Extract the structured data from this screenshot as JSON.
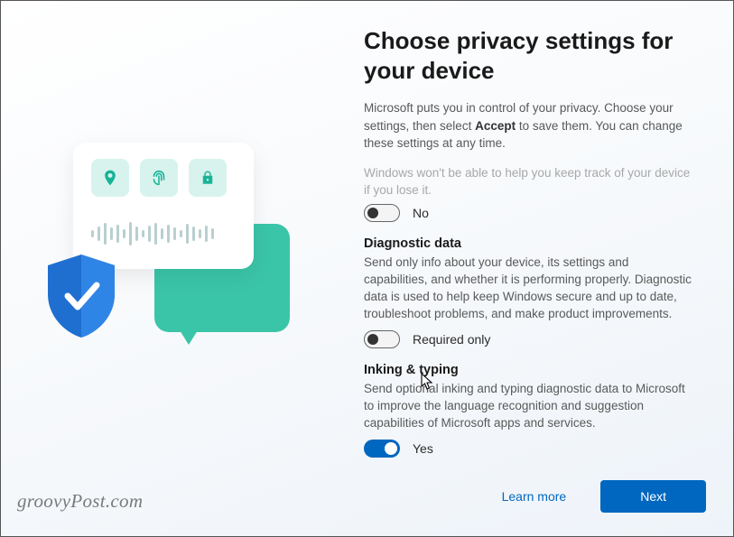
{
  "header": {
    "title": "Choose privacy settings for your device",
    "intro_prefix": "Microsoft puts you in control of your privacy. Choose your settings, then select ",
    "intro_bold": "Accept",
    "intro_suffix": " to save them. You can change these settings at any time."
  },
  "settings": {
    "partial_text": "Windows won't be able to help you keep track of your device if you lose it.",
    "find_device": {
      "state_label": "No",
      "on": false
    },
    "diagnostic": {
      "title": "Diagnostic data",
      "desc": "Send only info about your device, its settings and capabilities, and whether it is performing properly. Diagnostic data is used to help keep Windows secure and up to date, troubleshoot problems, and make product improvements.",
      "state_label": "Required only",
      "on": false
    },
    "inking": {
      "title": "Inking & typing",
      "desc": "Send optional inking and typing diagnostic data to Microsoft to improve the language recognition and suggestion capabilities of Microsoft apps and services.",
      "state_label": "Yes",
      "on": true
    }
  },
  "footer": {
    "learn_more": "Learn more",
    "next": "Next"
  },
  "watermark": "groovyPost.com",
  "icons": {
    "location": "location-pin-icon",
    "fingerprint": "fingerprint-icon",
    "lock": "lock-icon",
    "shield": "shield-check-icon"
  }
}
